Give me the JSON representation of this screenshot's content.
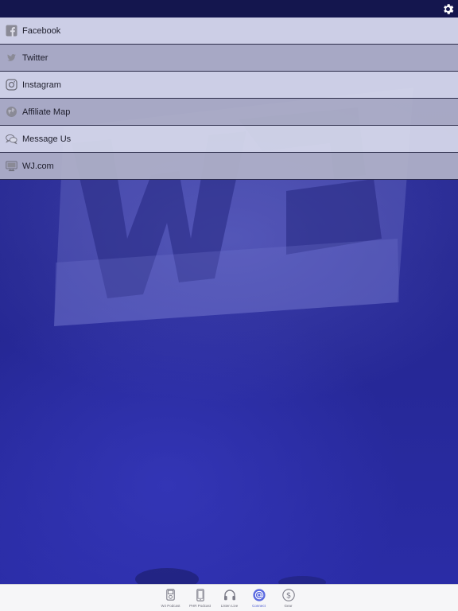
{
  "menu": {
    "items": [
      {
        "label": "Facebook",
        "icon": "facebook-icon"
      },
      {
        "label": "Twitter",
        "icon": "twitter-icon"
      },
      {
        "label": "Instagram",
        "icon": "instagram-icon"
      },
      {
        "label": "Affiliate Map",
        "icon": "globe-icon"
      },
      {
        "label": "Message Us",
        "icon": "chat-bubbles-icon"
      },
      {
        "label": "WJ.com",
        "icon": "monitor-icon"
      }
    ]
  },
  "tab_bar": {
    "tabs": [
      {
        "label": "WJ Podcast",
        "icon": "ipod-icon",
        "active": false
      },
      {
        "label": "PHR Podcast",
        "icon": "phone-icon",
        "active": false
      },
      {
        "label": "Listen Live",
        "icon": "headphones-icon",
        "active": false
      },
      {
        "label": "Connect",
        "icon": "at-sign-icon",
        "active": true
      },
      {
        "label": "Gear",
        "icon": "dollar-icon",
        "active": false
      }
    ]
  },
  "colors": {
    "status_bar": "#14164e",
    "background": "#24268f",
    "active_tab": "#4a5ad0"
  }
}
